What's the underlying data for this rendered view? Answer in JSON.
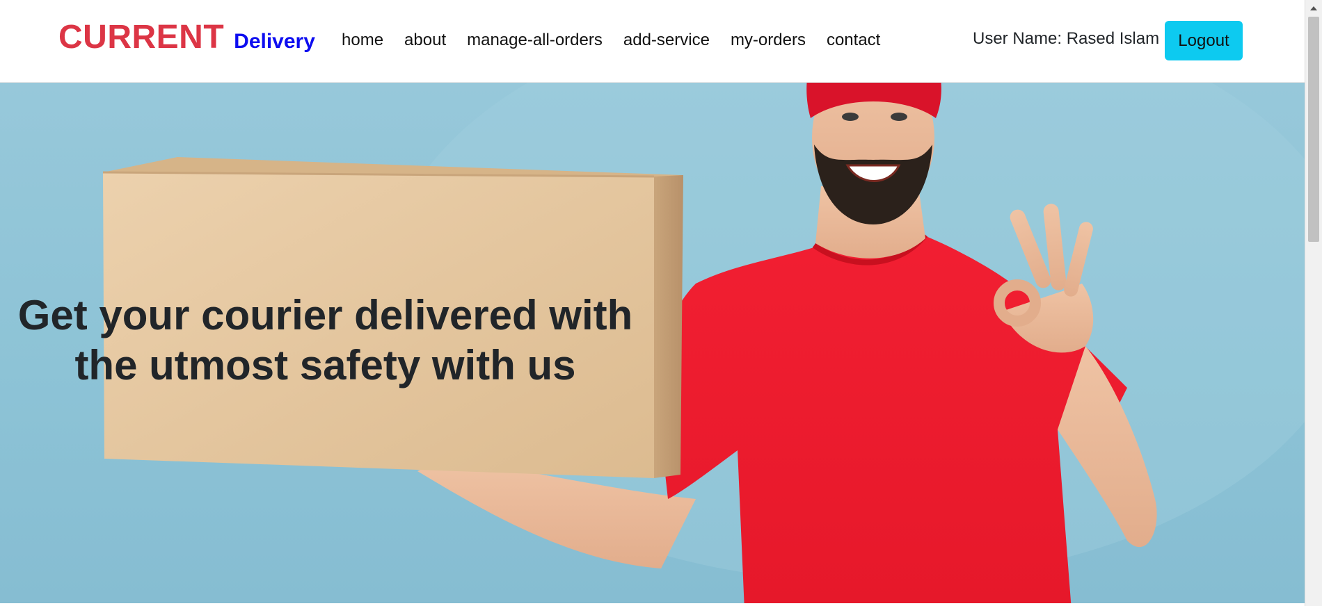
{
  "brand": {
    "name": "CURRENT",
    "subtitle": "Delivery"
  },
  "nav": {
    "links": [
      "home",
      "about",
      "manage-all-orders",
      "add-service",
      "my-orders",
      "contact"
    ]
  },
  "user": {
    "label": "User Name: Rased Islam"
  },
  "buttons": {
    "logout": "Logout"
  },
  "hero": {
    "line1": "Get your courier delivered with",
    "line2": "the utmost safety with us",
    "image": "delivery-man-holding-box",
    "colors": {
      "background": "#8dc3d6",
      "shirt": "#ee1c2e",
      "box": "#e6c59c"
    }
  },
  "colors": {
    "brand_main": "#dc3545",
    "brand_sub": "#0d0df0",
    "logout_button": "#0dcaf0",
    "heading": "#212529"
  }
}
